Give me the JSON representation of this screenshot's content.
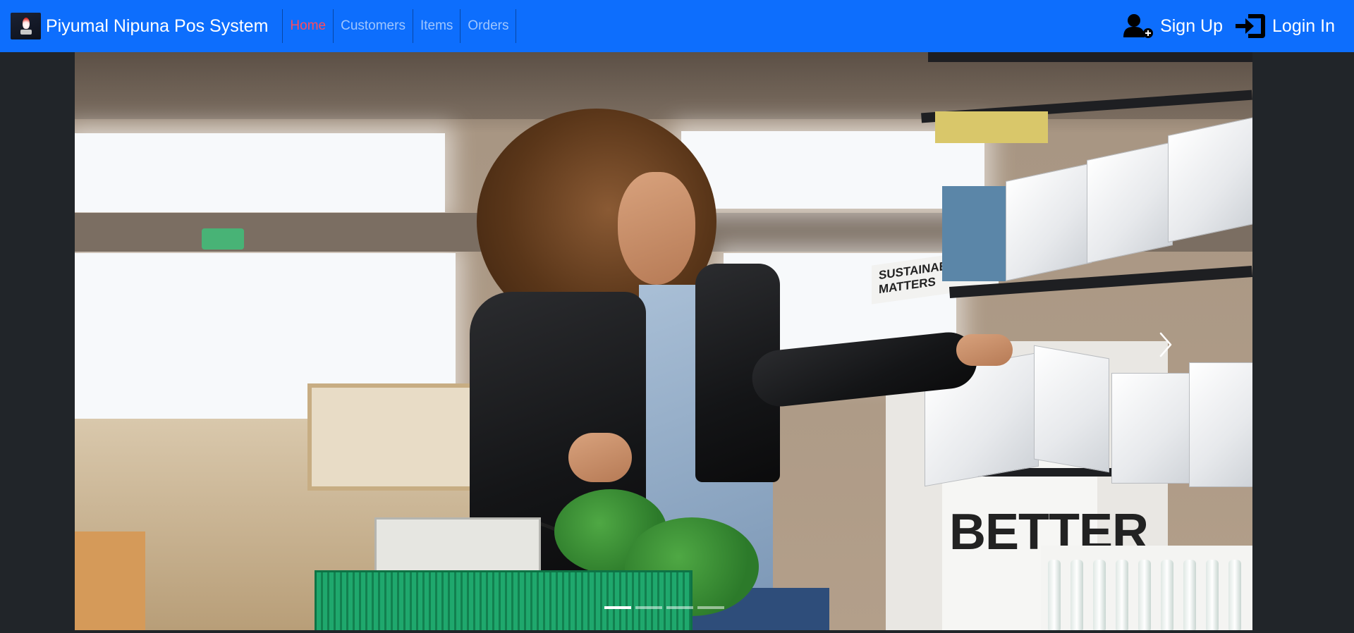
{
  "navbar": {
    "brand_name": "Piyumal Nipuna Pos System",
    "logo_icon": "logo-icon",
    "links": [
      {
        "label": "Home",
        "active": true
      },
      {
        "label": "Customers",
        "active": false
      },
      {
        "label": "Items",
        "active": false
      },
      {
        "label": "Orders",
        "active": false
      }
    ],
    "signup_label": "Sign Up",
    "signup_icon": "user-plus-icon",
    "login_label": "Login In",
    "login_icon": "sign-in-icon",
    "active_color": "#ff4b5c",
    "background_color": "#0d6efd"
  },
  "carousel": {
    "slide_count": 4,
    "active_slide": 1,
    "image_description_icon": "shopping-photo",
    "next_control_icon": "chevron-right-icon",
    "sign_text_1": "SUSTAINABILITY MATTERS",
    "sign_text_2": "BETTER"
  }
}
